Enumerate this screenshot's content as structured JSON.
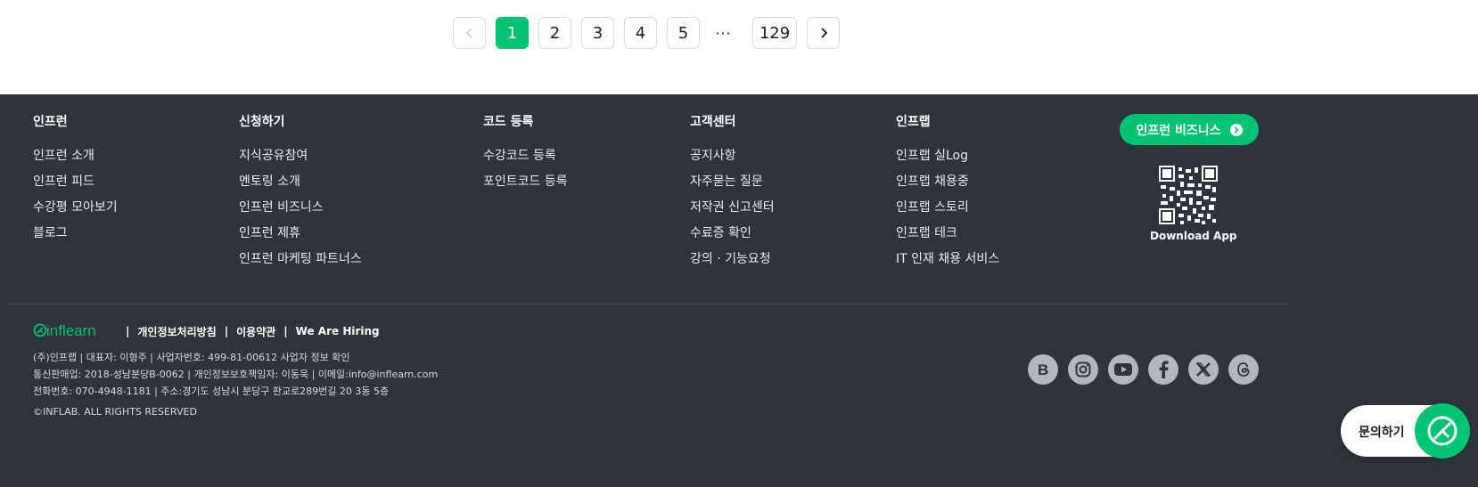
{
  "pagination": {
    "prev_icon": "chevron-left-icon",
    "pages": [
      "1",
      "2",
      "3",
      "4",
      "5"
    ],
    "ellipsis": "···",
    "last_page": "129",
    "current_page": "1",
    "next_icon": "chevron-right-icon"
  },
  "footer": {
    "columns": [
      {
        "title": "인프런",
        "links": [
          "인프런 소개",
          "인프런 피드",
          "수강평 모아보기",
          "블로그"
        ]
      },
      {
        "title": "신청하기",
        "links": [
          "지식공유참여",
          "멘토링 소개",
          "인프런 비즈니스",
          "인프런 제휴",
          "인프런 마케팅 파트너스"
        ]
      },
      {
        "title": "코드 등록",
        "links": [
          "수강코드 등록",
          "포인트코드 등록"
        ]
      },
      {
        "title": "고객센터",
        "links": [
          "공지사항",
          "자주묻는 질문",
          "저작권 신고센터",
          "수료증 확인",
          "강의 · 기능요청"
        ]
      },
      {
        "title": "인프랩",
        "links": [
          "인프랩 실Log",
          "인프랩 채용중",
          "인프랩 스토리",
          "인프랩 테크",
          "IT 인재 채용 서비스"
        ]
      }
    ],
    "business_button": "인프런 비즈니스",
    "download_app": "Download App",
    "logo_text": "inflearn",
    "bottom_links": [
      "개인정보처리방침",
      "이용약관",
      "We Are Hiring"
    ],
    "separator": "|",
    "company_lines": [
      "(주)인프랩 | 대표자: 이형주 | 사업자번호: 499-81-00612 사업자 정보 확인",
      "통신판매업: 2018-성남분당B-0062 | 개인정보보호책임자: 이동욱 | 이메일:info@inflearn.com",
      "전화번호: 070-4948-1181 | 주소:경기도 성남시 분당구 판교로289번길 20 3동 5층"
    ],
    "copyright": "©INFLAB. ALL RIGHTS RESERVED",
    "social_icons": [
      "blog-icon",
      "instagram-icon",
      "youtube-icon",
      "facebook-icon",
      "x-icon",
      "threads-icon"
    ]
  },
  "chat": {
    "label": "문의하기",
    "icon": "inquiry-leaf-icon"
  },
  "colors": {
    "accent": "#00c471",
    "footer_bg": "#2e333d",
    "social_bg": "#b3b6ba"
  }
}
